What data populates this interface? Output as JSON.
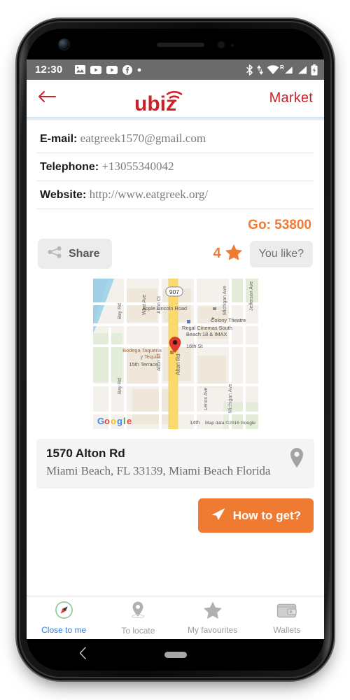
{
  "status_bar": {
    "time": "12:30",
    "left_icons": [
      "image-icon",
      "youtube-icon",
      "youtube-icon",
      "facebook-icon",
      "dot-icon"
    ],
    "right_icons": [
      "bluetooth-icon",
      "data-transfer-icon",
      "wifi-icon",
      "roaming-signal-icon",
      "signal-icon",
      "battery-icon"
    ],
    "roaming_label": "R",
    "background": "#6b6b6b"
  },
  "app_bar": {
    "back_label": "back-arrow",
    "logo_text": "ubiz",
    "market_label": "Market",
    "brand_color": "#cf2027"
  },
  "contact": {
    "rows": [
      {
        "label": "E-mail:",
        "value": "eatgreek1570@gmail.com"
      },
      {
        "label": "Telephone:",
        "value": "+13055340042"
      },
      {
        "label": "Website:",
        "value": "http://www.eatgreek.org/"
      }
    ]
  },
  "counter": {
    "go_text": "Go: 53800",
    "color": "#ef7b33"
  },
  "actions": {
    "share_label": "Share",
    "rating_value": "4",
    "like_label": "You like?",
    "star_color": "#ef7b33"
  },
  "map": {
    "attribution": "Map data ©2016 Google",
    "provider_logo": "Google",
    "labels": [
      "West Ave",
      "Alton Ct",
      "Bay Rd",
      "Michigan Ave",
      "Jefferson Ave",
      "Apple Lincoln Road",
      "Colony Theatre",
      "Regal Cinemas South",
      "Beach 18 & IMAX",
      "Bodega Taqueria",
      "y Tequila",
      "15th Terrace",
      "16th St",
      "Alton Rd",
      "Lenox Ave",
      "14th",
      "907"
    ],
    "marker": "map-pin-red"
  },
  "address": {
    "title": "1570 Alton Rd",
    "subtitle": "Miami Beach, FL 33139, Miami Beach Florida",
    "pin_icon": "location-pin-icon"
  },
  "howto": {
    "label": "How to get?",
    "icon": "paper-plane-icon",
    "color": "#ef7b33"
  },
  "tabs": [
    {
      "label": "Close to me",
      "icon": "compass-icon",
      "active": true
    },
    {
      "label": "To locate",
      "icon": "location-pin-icon",
      "active": false
    },
    {
      "label": "My favourites",
      "icon": "star-icon",
      "active": false
    },
    {
      "label": "Wallets",
      "icon": "wallet-icon",
      "active": false
    }
  ],
  "nav_bar": {
    "back_icon": "chevron-left-icon",
    "home_icon": "home-pill-icon"
  }
}
